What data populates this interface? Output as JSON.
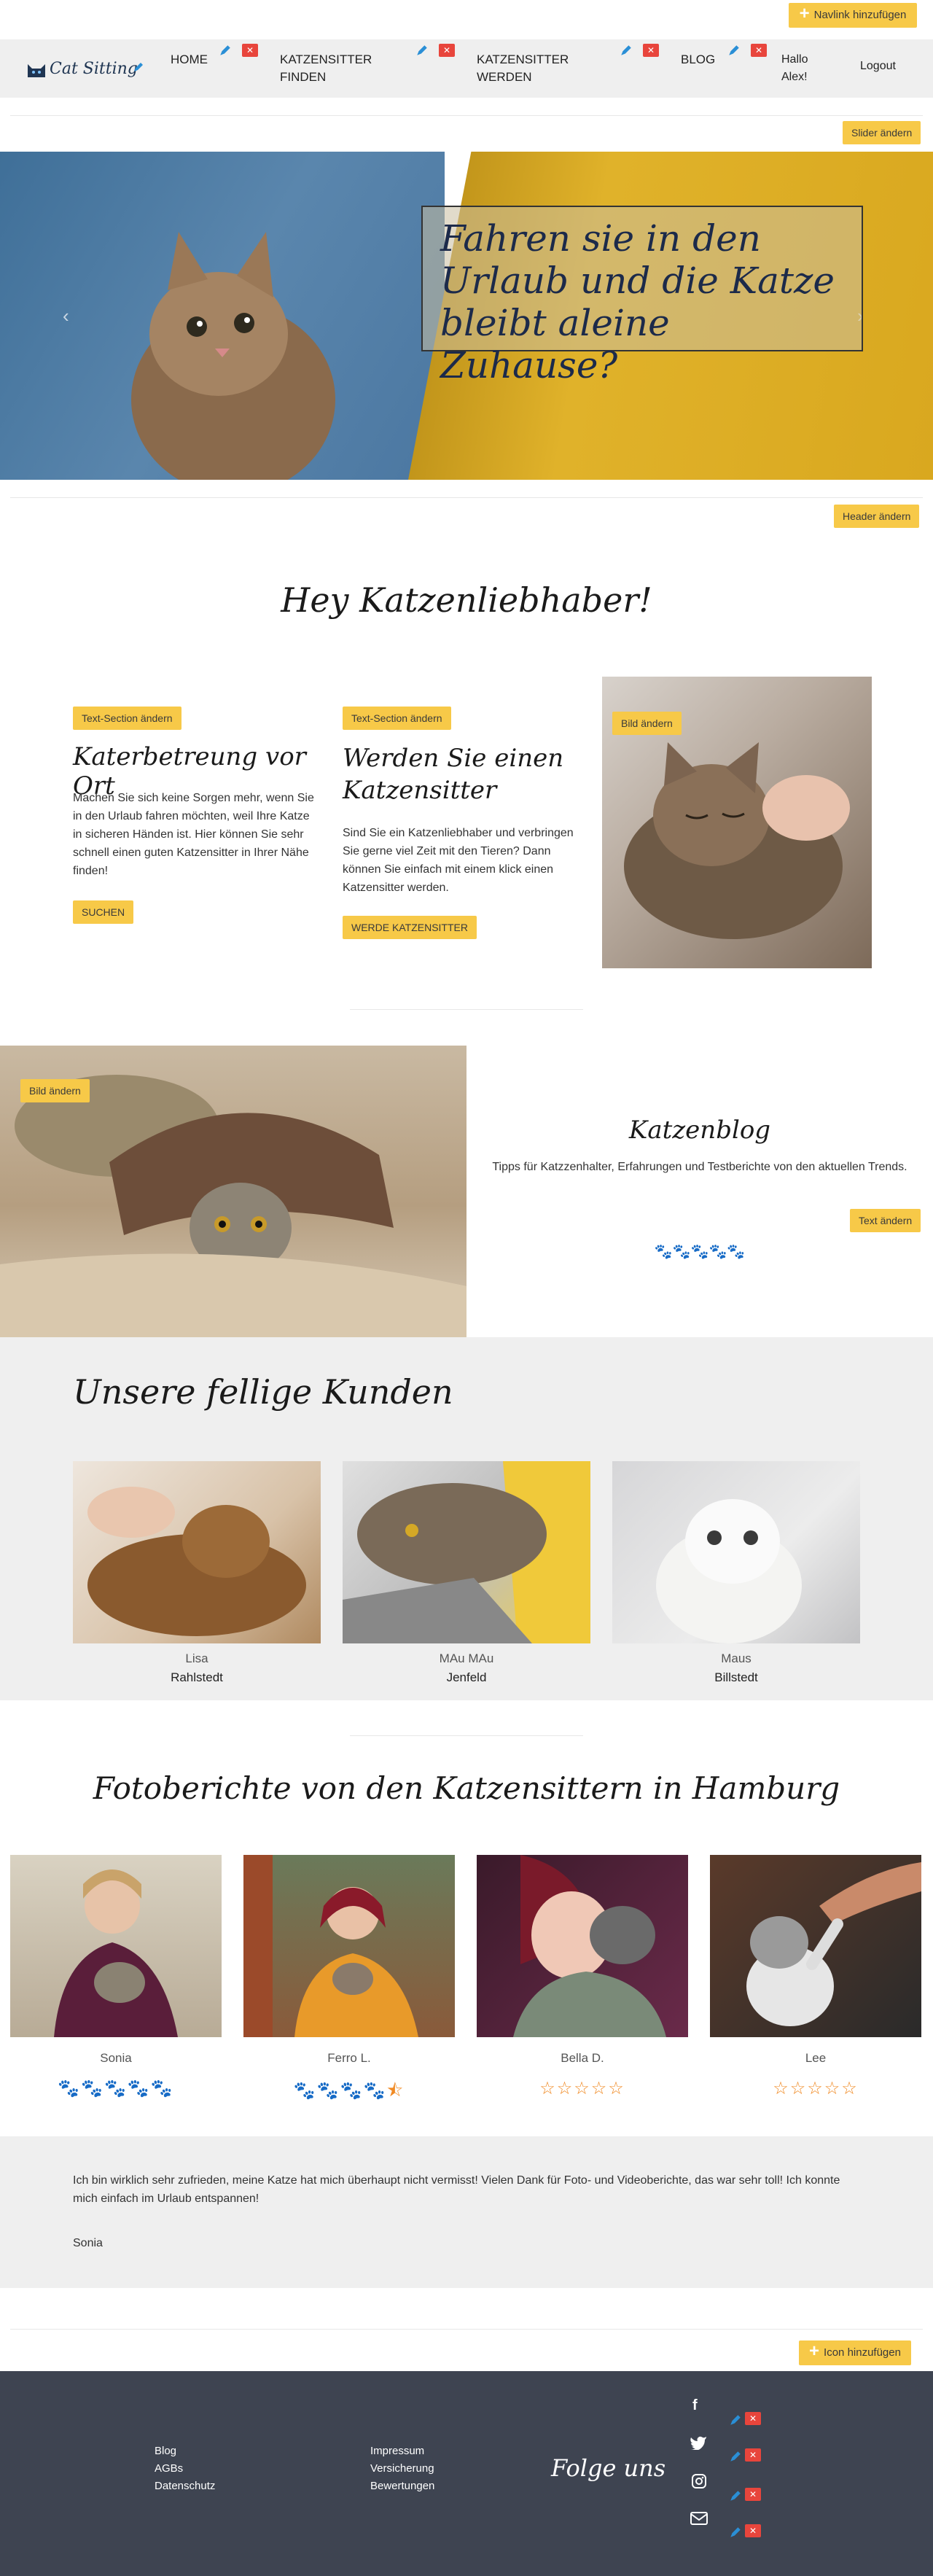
{
  "toolbar": {
    "add_navlink": "Navlink hinzufügen",
    "change_slider": "Slider ändern",
    "change_header": "Header ändern",
    "add_icon": "Icon hinzufügen"
  },
  "brand": {
    "name": "Cat Sitting"
  },
  "nav": {
    "items": [
      {
        "label": "HOME"
      },
      {
        "label": "KATZENSITTER FINDEN"
      },
      {
        "label": "KATZENSITTER WERDEN"
      },
      {
        "label": "BLOG"
      }
    ],
    "greeting": "Hallo Alex!",
    "logout": "Logout"
  },
  "hero": {
    "headline": "Fahren sie in den Urlaub und die Katze bleibt aleine Zuhause?"
  },
  "intro": {
    "title": "Hey Katzenliebhaber!",
    "col1": {
      "edit": "Text-Section ändern",
      "title": "Katerbetreung vor Ort",
      "text": "Machen Sie sich keine Sorgen mehr, wenn Sie in den Urlaub fahren möchten, weil Ihre Katze in sicheren Händen ist. Hier können Sie sehr schnell einen guten Katzensitter in Ihrer Nähe finden!",
      "button": "SUCHEN"
    },
    "col2": {
      "edit": "Text-Section ändern",
      "title": "Werden Sie einen Katzensitter",
      "text": "Sind Sie ein Katzenliebhaber und verbringen Sie gerne viel Zeit mit den Tieren? Dann können Sie einfach mit einem klick einen Katzensitter werden.",
      "button": "WERDE KATZENSITTER"
    },
    "image_edit": "Bild ändern"
  },
  "blog": {
    "image_edit": "Bild ändern",
    "title": "Katzenblog",
    "text": "Tipps für Katzzenhalter, Erfahrungen und Testberichte von den aktuellen Trends.",
    "edit": "Text ändern",
    "paws": "🐾🐾🐾🐾🐾"
  },
  "customers": {
    "title": "Unsere fellige Kunden",
    "items": [
      {
        "name": "Lisa",
        "place": "Rahlstedt"
      },
      {
        "name": "MAu MAu",
        "place": "Jenfeld"
      },
      {
        "name": "Maus",
        "place": "Billstedt"
      }
    ]
  },
  "reports": {
    "title": "Fotoberichte von den Katzensittern in Hamburg",
    "items": [
      {
        "name": "Sonia",
        "rating": 5
      },
      {
        "name": "Ferro L.",
        "rating": 4.5
      },
      {
        "name": "Bella D.",
        "rating": 0
      },
      {
        "name": "Lee",
        "rating": 0
      }
    ]
  },
  "testimonial": {
    "text": "Ich bin wirklich sehr zufrieden, meine Katze hat mich überhaupt nicht vermisst! Vielen Dank für Foto- und Videoberichte, das war sehr toll! Ich konnte mich einfach im Urlaub entspannen!",
    "author": "Sonia"
  },
  "footer": {
    "col1": [
      "Blog",
      "AGBs",
      "Datenschutz"
    ],
    "col2": [
      "Impressum",
      "Versicherung",
      "Bewertungen"
    ],
    "follow": "Folge uns"
  },
  "colors": {
    "accent": "#f7c948",
    "footer": "#3e4451",
    "star": "#f08a24",
    "delete": "#e8453c",
    "gray_band": "#efefef"
  }
}
